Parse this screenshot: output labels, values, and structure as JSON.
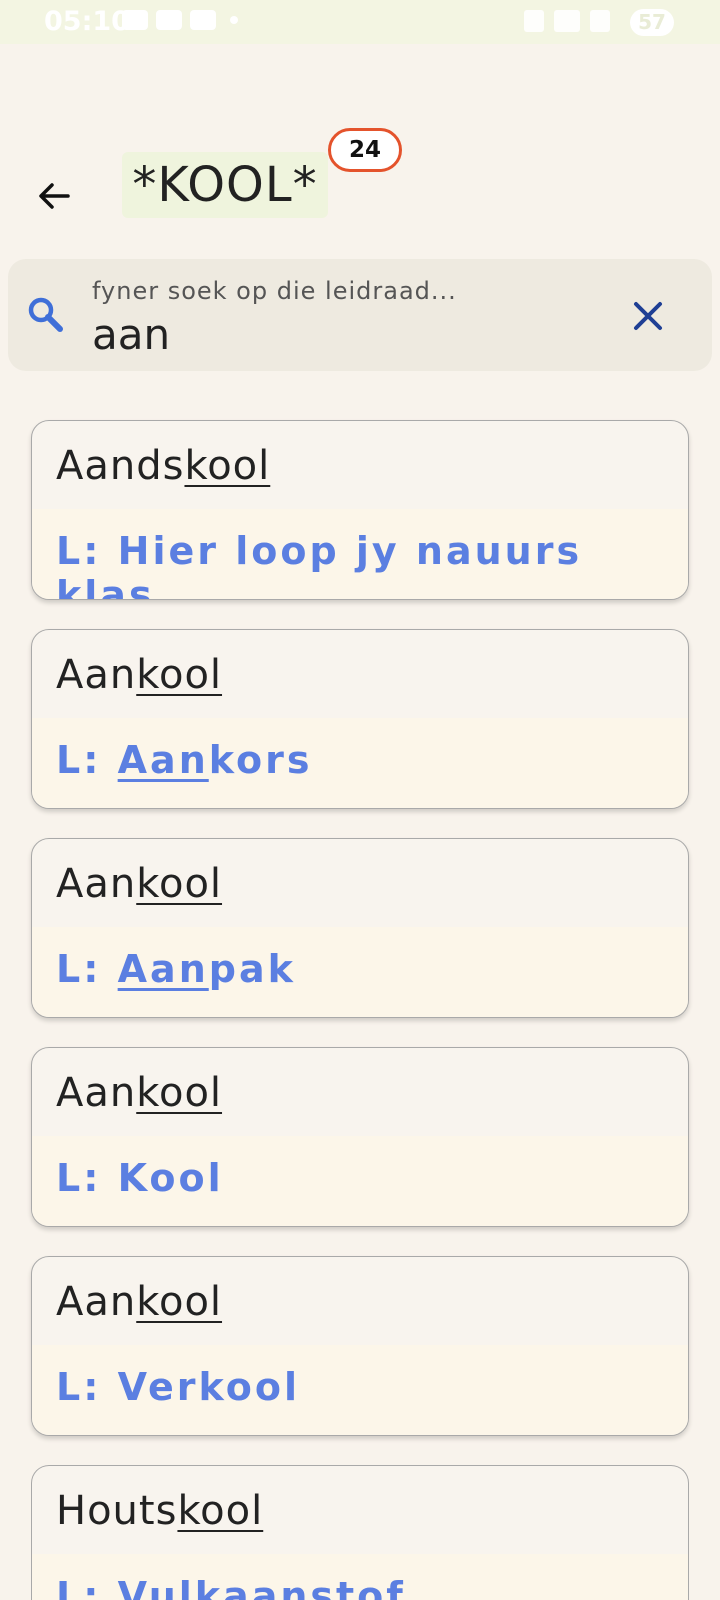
{
  "status_bar": {
    "time": "05:10",
    "battery": "57"
  },
  "header": {
    "back_icon": "arrow-left-icon",
    "title": "*KOOL*",
    "count": "24"
  },
  "search": {
    "placeholder": "fyner soek op die leidraad...",
    "value": "aan",
    "search_icon": "magnifier-icon",
    "clear_icon": "close-icon"
  },
  "results": [
    {
      "word_prefix": "Aands",
      "word_match": "kool",
      "clue_label": "L: ",
      "clue_match": "",
      "clue_rest": "Hier loop jy nauurs klas"
    },
    {
      "word_prefix": "Aan",
      "word_match": "kool",
      "clue_label": "L: ",
      "clue_match": "Aan",
      "clue_rest": "kors"
    },
    {
      "word_prefix": "Aan",
      "word_match": "kool",
      "clue_label": "L: ",
      "clue_match": "Aan",
      "clue_rest": "pak"
    },
    {
      "word_prefix": "Aan",
      "word_match": "kool",
      "clue_label": "L: ",
      "clue_match": "",
      "clue_rest": "Kool"
    },
    {
      "word_prefix": "Aan",
      "word_match": "kool",
      "clue_label": "L: ",
      "clue_match": "",
      "clue_rest": "Verkool"
    },
    {
      "word_prefix": "Houts",
      "word_match": "kool",
      "clue_label": "L: ",
      "clue_match": "",
      "clue_rest": "Vulkaanstof"
    }
  ],
  "colors": {
    "accent": "#5b7fe1",
    "badge_border": "#e4532c",
    "background": "#f8f3ec"
  }
}
